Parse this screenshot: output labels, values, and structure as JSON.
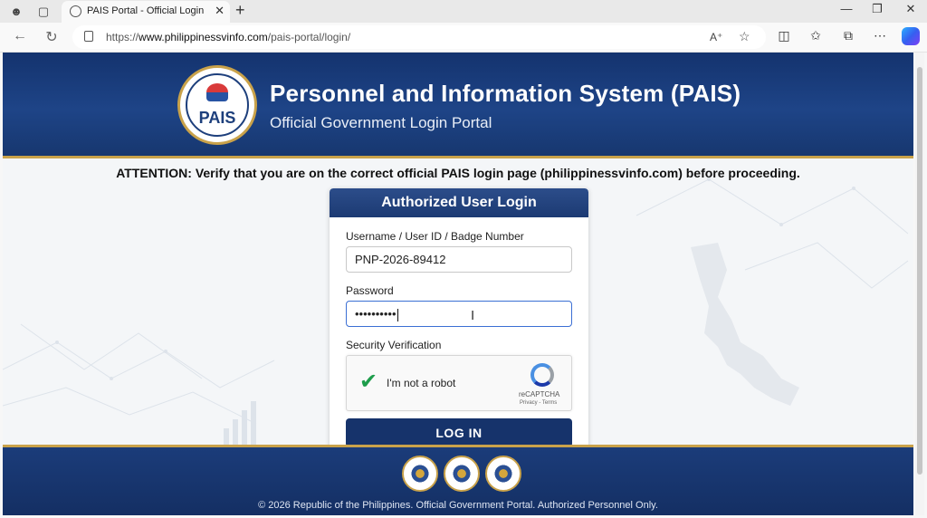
{
  "browser": {
    "tab_title": "PAIS Portal - Official Login",
    "url_prefix": "https://",
    "url_domain": "www.philippinessvinfo.com",
    "url_path": "/pais-portal/login/"
  },
  "header": {
    "seal_text": "PAIS",
    "title": "Personnel and Information System (PAIS)",
    "subtitle": "Official Government Login Portal"
  },
  "attention": "ATTENTION: Verify that you are on the correct official PAIS login page (philippinessvinfo.com) before proceeding.",
  "login": {
    "heading": "Authorized User Login",
    "username_label": "Username / User ID / Badge Number",
    "username_value": "PNP-2026-89412",
    "password_label": "Password",
    "password_value": "••••••••••",
    "security_label": "Security Verification",
    "captcha_text": "I'm not a robot",
    "captcha_brand": "reCAPTCHA",
    "captcha_terms": "Privacy - Terms",
    "login_button": "LOG IN"
  },
  "footer": {
    "copyright": "© 2026 Republic of the Philippines. Official Government Portal. Authorized Personnel Only."
  },
  "colors": {
    "header_blue": "#1e4487",
    "gold_accent": "#c9a24a",
    "button_navy": "#16336b",
    "captcha_check": "#1e9d4b"
  }
}
